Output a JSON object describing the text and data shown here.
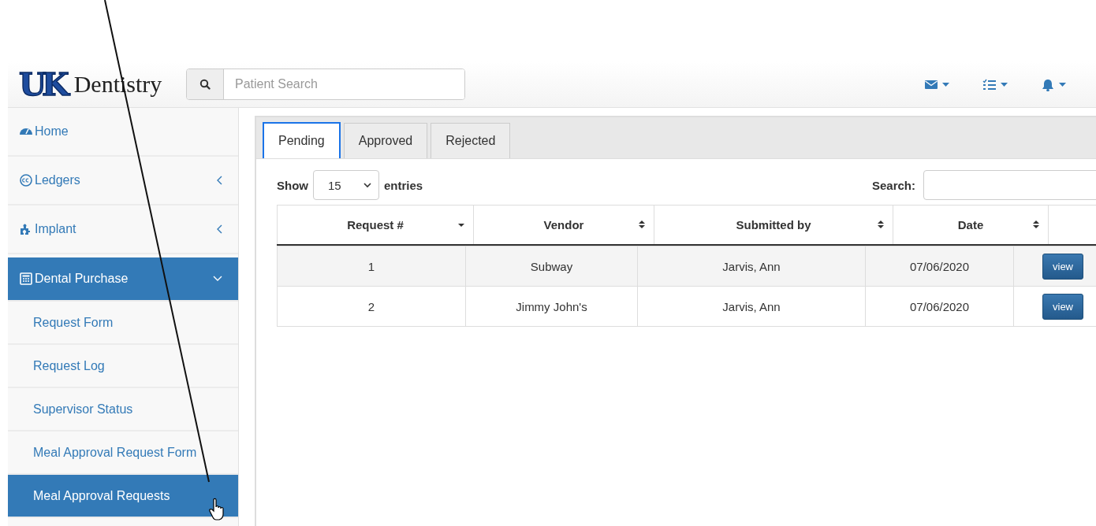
{
  "header": {
    "logo_mark": "UK",
    "logo_text": "Dentistry",
    "search": {
      "placeholder": "Patient Search"
    },
    "icons": [
      {
        "kind": "mail"
      },
      {
        "kind": "tasks"
      },
      {
        "kind": "bell"
      }
    ]
  },
  "sidebar": {
    "items": [
      {
        "label": "Home",
        "selected": false
      },
      {
        "label": "Ledgers",
        "expanded": false,
        "selected": false
      },
      {
        "label": "Implant",
        "expanded": false,
        "selected": false
      },
      {
        "label": "Dental Purchase",
        "expanded": true,
        "selected": true,
        "children": [
          {
            "label": "Request Form",
            "selected": false
          },
          {
            "label": "Request Log",
            "selected": false
          },
          {
            "label": "Supervisor Status",
            "selected": false
          },
          {
            "label": "Meal Approval Request Form",
            "selected": false
          },
          {
            "label": "Meal Approval Requests",
            "selected": true
          }
        ]
      }
    ]
  },
  "tabs": [
    {
      "label": "Pending",
      "selected": true
    },
    {
      "label": "Approved",
      "selected": false
    },
    {
      "label": "Rejected",
      "selected": false
    }
  ],
  "table_controls": {
    "show_label": "Show",
    "page_size": "15",
    "entries_label": "entries",
    "search_label": "Search:"
  },
  "table": {
    "columns": [
      {
        "label": "Request #",
        "sorted": true
      },
      {
        "label": "Vendor",
        "sorted": false
      },
      {
        "label": "Submitted by",
        "sorted": false
      },
      {
        "label": "Date",
        "sorted": false
      }
    ],
    "rows": [
      {
        "cells": [
          "1",
          "Subway",
          "Jarvis, Ann",
          "07/06/2020"
        ],
        "action": "view"
      },
      {
        "cells": [
          "2",
          "Jimmy John's",
          "Jarvis, Ann",
          "07/06/2020"
        ],
        "action": "view"
      }
    ]
  }
}
